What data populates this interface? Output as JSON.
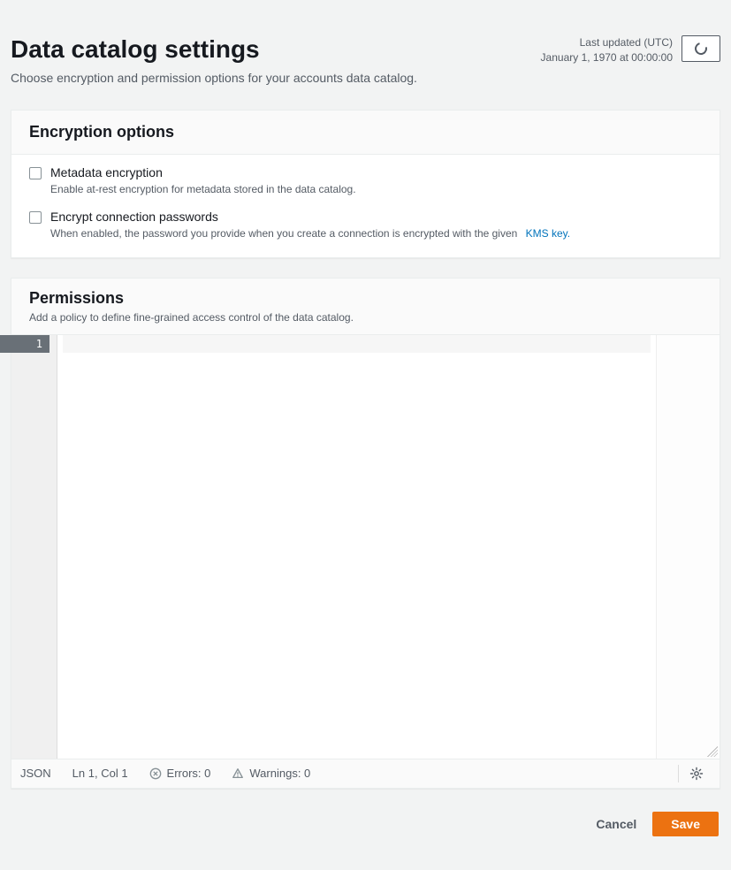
{
  "header": {
    "title": "Data catalog settings",
    "subtitle": "Choose encryption and permission options for your accounts data catalog.",
    "last_updated_label": "Last updated (UTC)",
    "last_updated_value": "January 1, 1970 at 00:00:00"
  },
  "encryption": {
    "title": "Encryption options",
    "metadata": {
      "label": "Metadata encryption",
      "desc": "Enable at-rest encryption for metadata stored in the data catalog."
    },
    "conn": {
      "label": "Encrypt connection passwords",
      "desc": "When enabled, the password you provide when you create a connection is encrypted with the given",
      "link": "KMS key."
    }
  },
  "permissions": {
    "title": "Permissions",
    "desc": "Add a policy to define fine-grained access control of the data catalog.",
    "gutter_lines": [
      "1"
    ]
  },
  "statusbar": {
    "lang": "JSON",
    "pos": "Ln 1, Col 1",
    "errors": "Errors: 0",
    "warnings": "Warnings: 0"
  },
  "footer": {
    "cancel": "Cancel",
    "save": "Save"
  }
}
